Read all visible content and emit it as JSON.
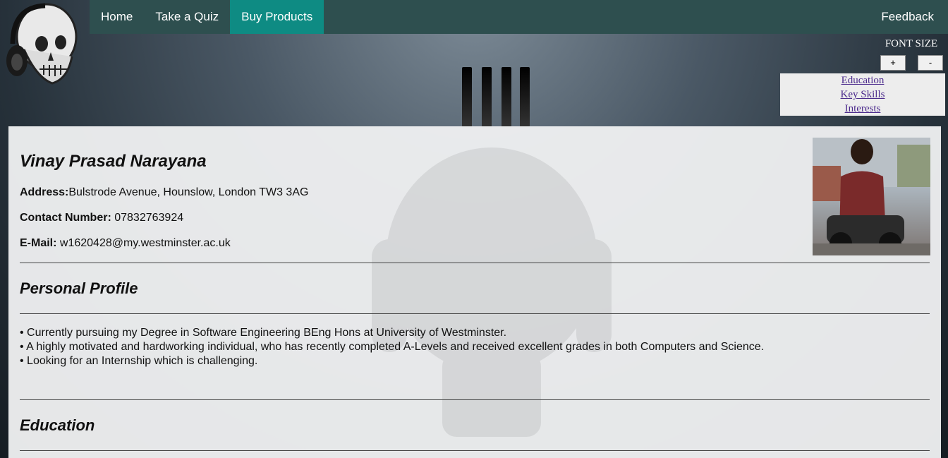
{
  "nav": {
    "items": [
      {
        "label": "Home"
      },
      {
        "label": "Take a Quiz"
      },
      {
        "label": "Buy Products"
      }
    ],
    "feedback": "Feedback"
  },
  "font_size": {
    "label": "FONT SIZE",
    "plus": "+",
    "minus": "-"
  },
  "quick_links": [
    "Education",
    "Key Skills",
    "Interests"
  ],
  "profile": {
    "name": "Vinay Prasad Narayana",
    "address_label": "Address:",
    "address": "Bulstrode Avenue, Hounslow, London TW3 3AG",
    "contact_label": "Contact Number:",
    "contact": "07832763924",
    "email_label": "E-Mail:",
    "email": "w1620428@my.westminster.ac.uk"
  },
  "sections": {
    "personal_profile": "Personal Profile",
    "education": "Education"
  },
  "personal_profile_bullets": [
    "• Currently pursuing my Degree in Software Engineering BEng Hons at University of Westminster.",
    "• A highly motivated and hardworking individual, who has recently completed A-Levels and received excellent grades in both Computers and Science.",
    "• Looking for an Internship which is challenging."
  ],
  "colors": {
    "navbar": "#2e4f4f",
    "nav_active": "#0e8b83",
    "link": "#4b2a8c"
  }
}
